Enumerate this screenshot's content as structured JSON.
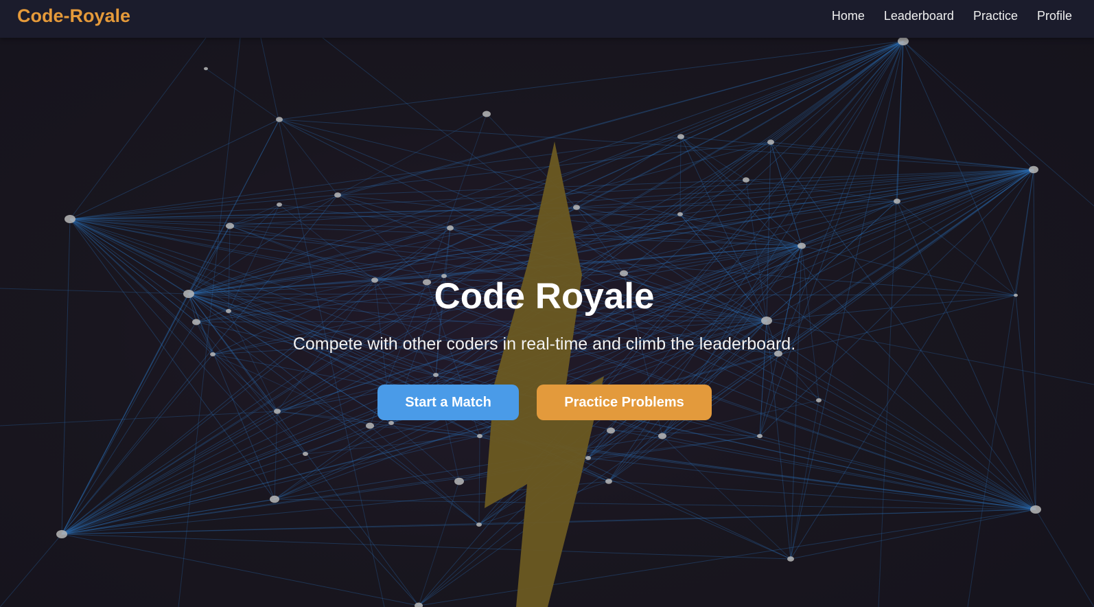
{
  "navbar": {
    "brand": "Code-Royale",
    "links": [
      "Home",
      "Leaderboard",
      "Practice",
      "Profile"
    ]
  },
  "hero": {
    "title": "Code Royale",
    "subtitle": "Compete with other coders in real-time and climb the leaderboard.",
    "primary_button": "Start a Match",
    "secondary_button": "Practice Problems"
  },
  "colors": {
    "brand": "#e59a3a",
    "primary_button": "#4a9be8",
    "secondary_button": "#e39a3c",
    "navbar_bg": "#1b1c2c",
    "page_bg": "#16141f",
    "network_lines": "#2b6fb8",
    "network_nodes": "#b9b9b9",
    "bolt": "#6b5a22"
  },
  "icons": {
    "background_decoration": "lightning-bolt-icon",
    "network": "network-graph"
  }
}
